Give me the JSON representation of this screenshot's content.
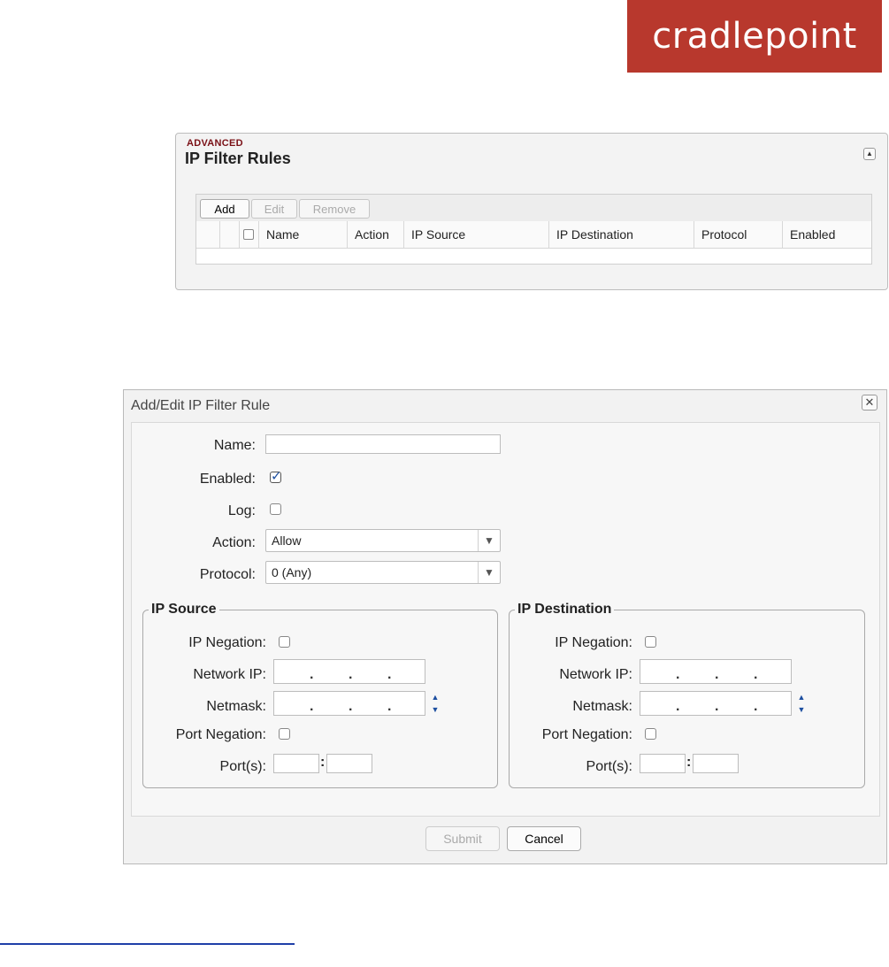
{
  "brand": {
    "logo_text": "cradlepoint",
    "logo_color": "#b8382d"
  },
  "rules_panel": {
    "kicker": "ADVANCED",
    "title": "IP Filter Rules",
    "toolbar": {
      "add": "Add",
      "edit": "Edit",
      "remove": "Remove"
    },
    "columns": [
      "Name",
      "Action",
      "IP Source",
      "IP Destination",
      "Protocol",
      "Enabled"
    ]
  },
  "dialog": {
    "title": "Add/Edit IP Filter Rule",
    "close_glyph": "✕",
    "fields": {
      "name_label": "Name:",
      "name_value": "",
      "enabled_label": "Enabled:",
      "enabled_checked": true,
      "log_label": "Log:",
      "log_checked": false,
      "action_label": "Action:",
      "action_value": "Allow",
      "protocol_label": "Protocol:",
      "protocol_value": "0 (Any)"
    },
    "source": {
      "legend": "IP Source",
      "ip_negation_label": "IP Negation:",
      "network_ip_label": "Network IP:",
      "netmask_label": "Netmask:",
      "port_negation_label": "Port Negation:",
      "ports_label": "Port(s):"
    },
    "destination": {
      "legend": "IP Destination",
      "ip_negation_label": "IP Negation:",
      "network_ip_label": "Network IP:",
      "netmask_label": "Netmask:",
      "port_negation_label": "Port Negation:",
      "ports_label": "Port(s):"
    },
    "buttons": {
      "submit": "Submit",
      "cancel": "Cancel"
    },
    "ip_dot": ".",
    "port_sep": ":",
    "accent": "#1d4fa0"
  }
}
